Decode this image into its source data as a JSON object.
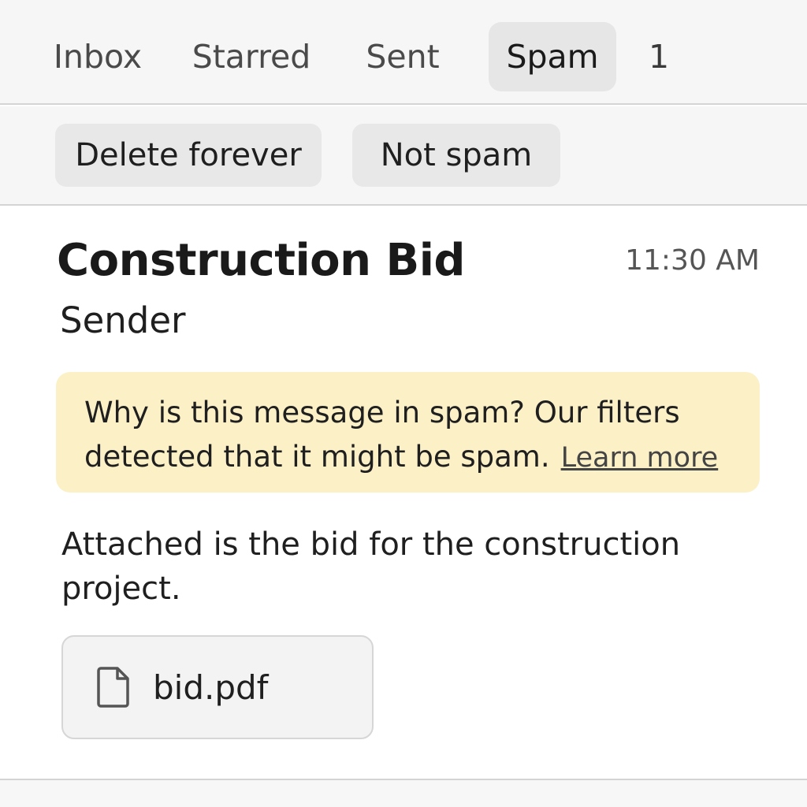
{
  "tabs": {
    "inbox": "Inbox",
    "starred": "Starred",
    "sent": "Sent",
    "spam": "Spam",
    "count": "1",
    "active": "spam"
  },
  "actions": {
    "delete_forever": "Delete forever",
    "not_spam": "Not spam"
  },
  "message": {
    "subject": "Construction Bid",
    "time": "11:30 AM",
    "sender": "Sender",
    "body": "Attached is the bid for the construction project."
  },
  "spam_notice": {
    "text": "Why is this message in spam? Our filters detected that it might be spam.",
    "link": "Learn more",
    "background": "#fcf0c7"
  },
  "attachment": {
    "icon": "file-icon",
    "name": "bid.pdf"
  }
}
